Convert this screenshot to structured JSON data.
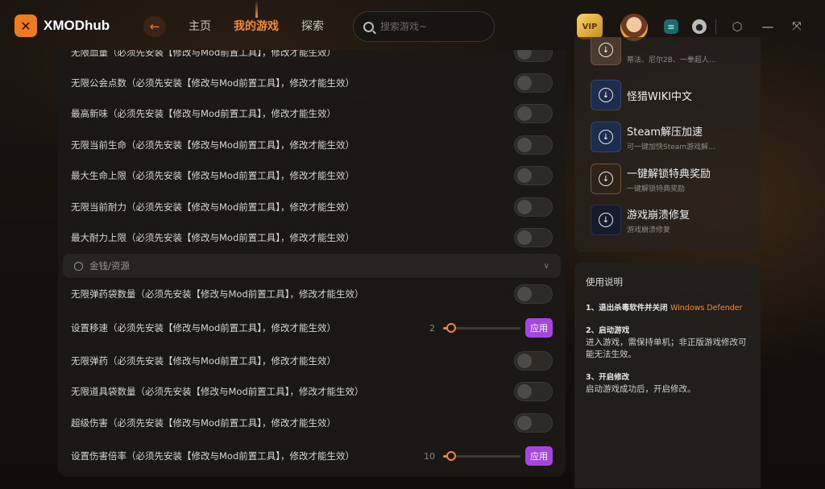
{
  "app": {
    "name": "XMODhub"
  },
  "nav": {
    "home": "主页",
    "my_games": "我的游戏",
    "explore": "探索"
  },
  "search": {
    "placeholder": "搜索游戏~"
  },
  "vip_label": "VIP",
  "colors": {
    "accent": "#f68b2c",
    "apply": "#a546e0",
    "tool_bg": "#1c2c4c"
  },
  "partial_top_row": "无限血量（必须先安装【修改与Mod前置工具】，修改才能生效）",
  "rows_a": [
    "无限公会点数（必须先安装【修改与Mod前置工具】，修改才能生效）",
    "最高新味（必须先安装【修改与Mod前置工具】，修改才能生效）",
    "无限当前生命（必须先安装【修改与Mod前置工具】，修改才能生效）",
    "最大生命上限（必须先安装【修改与Mod前置工具】，修改才能生效）",
    "无限当前耐力（必须先安装【修改与Mod前置工具】，修改才能生效）",
    "最大耐力上限（必须先安装【修改与Mod前置工具】，修改才能生效）"
  ],
  "section_money": "金钱/资源",
  "rows_b": [
    "无限弹药袋数量（必须先安装【修改与Mod前置工具】，修改才能生效）",
    "设置移速（必须先安装【修改与Mod前置工具】，修改才能生效）",
    "无限弹药（必须先安装【修改与Mod前置工具】，修改才能生效）",
    "无限道具袋数量（必须先安装【修改与Mod前置工具】，修改才能生效）",
    "超级伤害（必须先安装【修改与Mod前置工具】，修改才能生效）",
    "设置伤害倍率（必须先安装【修改与Mod前置工具】，修改才能生效）"
  ],
  "slider_speed": {
    "value": "2",
    "level": 0.04
  },
  "slider_damage": {
    "value": "10",
    "level": 0.02
  },
  "apply_label": "应用",
  "tools": [
    {
      "title": "",
      "subtitle": "蒂法、尼尔2B、一拳超人..."
    },
    {
      "title": "怪猎WIKI中文",
      "subtitle": ""
    },
    {
      "title": "Steam解压加速",
      "subtitle": "可一键加快Steam游戏解..."
    },
    {
      "title": "一键解锁特典奖励",
      "subtitle": "一键解锁特典奖励"
    },
    {
      "title": "游戏崩溃修复",
      "subtitle": "游戏崩溃修复"
    }
  ],
  "usage": {
    "title": "使用说明",
    "step1_head": "1、退出杀毒软件并关闭",
    "step1_highlight": "Windows Defender",
    "step2_head": "2、启动游戏",
    "step2_body": "进入游戏，需保持单机；非正版游戏修改可能无法生效。",
    "step3_head": "3、开启修改",
    "step3_body": "启动游戏成功后，开启修改。"
  }
}
